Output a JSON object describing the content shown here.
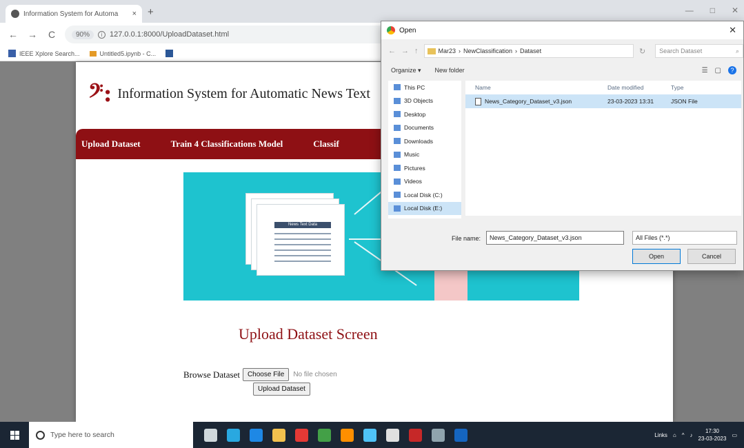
{
  "browser": {
    "tab_title": "Information System for Automa",
    "tab_close": "×",
    "new_tab": "+",
    "window_controls": [
      "—",
      "□",
      "✕"
    ],
    "nav": {
      "back": "←",
      "forward": "→",
      "reload": "C"
    },
    "zoom": "90%",
    "url": "127.0.0.1:8000/UploadDataset.html",
    "bookmarks": [
      {
        "label": "IEEE Xplore Search...",
        "icon": "ieee-icon"
      },
      {
        "label": "Untitled5.ipynb - C...",
        "icon": "colab-icon"
      },
      {
        "label": "",
        "icon": "word-icon"
      }
    ]
  },
  "page": {
    "logo": "𝄢:",
    "title": "Information System for Automatic News Text",
    "nav": [
      "Upload Dataset",
      "Train 4 Classifications Model",
      "Classif"
    ],
    "banner_doc_header": "News Text Data",
    "heading": "Upload Dataset Screen",
    "form": {
      "label": "Browse Dataset",
      "choose_button": "Choose File",
      "no_file": "No file chosen",
      "upload_button": "Upload Dataset"
    }
  },
  "dialog": {
    "title": "Open",
    "close": "✕",
    "breadcrumb": [
      "Mar23",
      "NewClassification",
      "Dataset"
    ],
    "search_placeholder": "Search Dataset",
    "toolbar": {
      "organize": "Organize ▾",
      "new_folder": "New folder"
    },
    "sidebar": [
      "This PC",
      "3D Objects",
      "Desktop",
      "Documents",
      "Downloads",
      "Music",
      "Pictures",
      "Videos",
      "Local Disk (C:)",
      "Local Disk (E:)"
    ],
    "sidebar_active_index": 9,
    "columns": {
      "name": "Name",
      "date": "Date modified",
      "type": "Type"
    },
    "files": [
      {
        "name": "News_Category_Dataset_v3.json",
        "date": "23-03-2023 13:31",
        "type": "JSON File"
      }
    ],
    "file_name_label": "File name:",
    "file_name_value": "News_Category_Dataset_v3.json",
    "file_type": "All Files (*.*)",
    "open_button": "Open",
    "cancel_button": "Cancel"
  },
  "taskbar": {
    "search_placeholder": "Type here to search",
    "app_colors": [
      "#cfd8dc",
      "#29a8e0",
      "#1e88e5",
      "#f2c14e",
      "#e53935",
      "#43a047",
      "#ff8f00",
      "#4fc3f7",
      "#e0e0e0",
      "#c62828",
      "#90a4ae",
      "#1565c0"
    ],
    "tray_text": "Links",
    "time": "17:30",
    "date": "23-03-2023"
  },
  "colors": {
    "brand": "#8e1014",
    "banner": "#1ec3cf",
    "taskbar": "#1b2634",
    "selection": "#cce4f7"
  }
}
